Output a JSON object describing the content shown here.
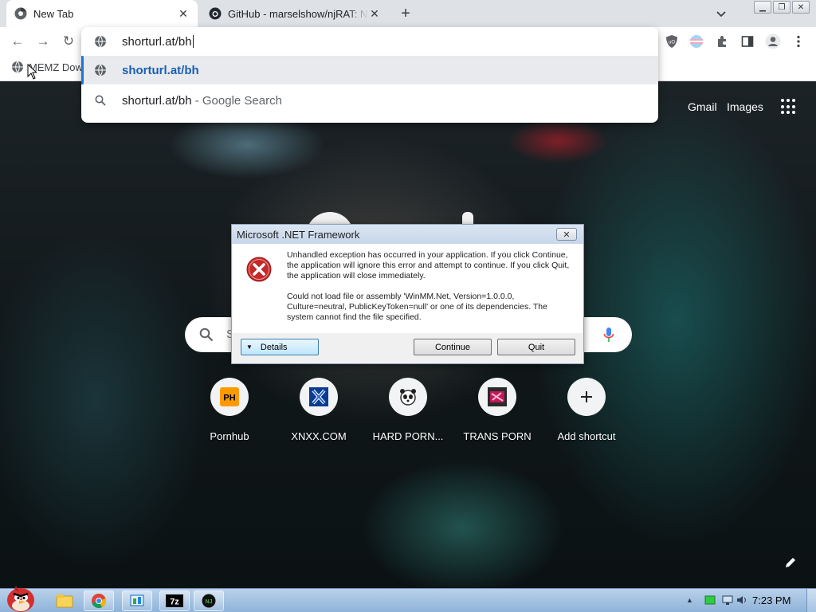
{
  "browser": {
    "tabs": [
      {
        "title": "New Tab",
        "favicon": "chrome-icon",
        "active": true
      },
      {
        "title": "GitHub - marselshow/njRAT: N",
        "favicon": "github-icon",
        "active": false
      }
    ],
    "new_tab_label": "+",
    "omnibox": {
      "input_value": "shorturl.at/bh",
      "suggestions": [
        {
          "text": "shorturl.at/bh",
          "description": "",
          "icon": "globe-icon"
        },
        {
          "text": "shorturl.at/bh",
          "description": " - Google Search",
          "icon": "search-icon"
        }
      ]
    },
    "bookmarks": [
      {
        "label": "MEMZ Dow",
        "icon": "globe-icon"
      }
    ]
  },
  "newtab_page": {
    "header_links": [
      "Gmail",
      "Images"
    ],
    "search_placeholder": "S",
    "shortcuts": [
      {
        "title": "Pornhub",
        "icon": "ph-icon"
      },
      {
        "title": "XNXX.COM",
        "icon": "x-icon"
      },
      {
        "title": "HARD PORN...",
        "icon": "panda-icon"
      },
      {
        "title": "TRANS PORN",
        "icon": "tp-icon"
      },
      {
        "title": "Add shortcut",
        "icon": "plus-icon"
      }
    ],
    "ph_badge": "PH"
  },
  "dialog": {
    "title": "Microsoft .NET Framework",
    "message_1": "Unhandled exception has occurred in your application. If you click Continue, the application will ignore this error and attempt to continue. If you click Quit, the application will close immediately.",
    "message_2": "Could not load file or assembly 'WinMM.Net, Version=1.0.0.0, Culture=neutral, PublicKeyToken=null' or one of its dependencies. The system cannot find the file specified.",
    "details_label": "Details",
    "continue_label": "Continue",
    "quit_label": "Quit"
  },
  "taskbar": {
    "clock": "7:23 PM",
    "apps": [
      "explorer-icon",
      "chrome-icon",
      "control-panel-icon",
      "7zip-icon",
      "njrat-icon"
    ],
    "seven_zip_label": "7z",
    "njrat_label": "NJ"
  },
  "colors": {
    "accent": "#1a73e8",
    "dialog_error": "#c62828",
    "taskbar": "#a8c4e4"
  }
}
